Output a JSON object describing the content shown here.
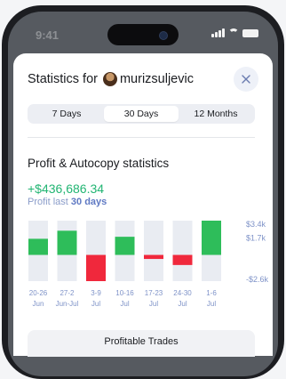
{
  "status_bar": {
    "time": "9:41"
  },
  "header": {
    "title_prefix": "Statistics for",
    "username": "murizsuljevic"
  },
  "tabs": [
    {
      "label": "7 Days",
      "active": false
    },
    {
      "label": "30 Days",
      "active": true
    },
    {
      "label": "12 Months",
      "active": false
    }
  ],
  "section": {
    "title": "Profit & Autocopy statistics",
    "profit_value": "+$436,686.34",
    "profit_label": "Profit last",
    "profit_period": "30 days"
  },
  "chart_data": {
    "type": "bar",
    "categories": [
      {
        "range": "20-26",
        "month": "Jun"
      },
      {
        "range": "27-2",
        "month": "Jun-Jul"
      },
      {
        "range": "3-9",
        "month": "Jul"
      },
      {
        "range": "10-16",
        "month": "Jul"
      },
      {
        "range": "17-23",
        "month": "Jul"
      },
      {
        "range": "24-30",
        "month": "Jul"
      },
      {
        "range": "1-6",
        "month": "Jul"
      }
    ],
    "values": [
      1.6,
      2.4,
      -2.6,
      1.8,
      -0.4,
      -1.0,
      3.4
    ],
    "y_ticks": [
      "$3.4k",
      "$1.7k",
      "-$2.6k"
    ],
    "ylim": [
      -2.6,
      3.4
    ],
    "colors": {
      "positive": "#2ebd5a",
      "negative": "#f0283c",
      "track": "#e9ecf2",
      "tick": "#7f93c8"
    }
  },
  "card": {
    "title": "Profitable Trades"
  }
}
